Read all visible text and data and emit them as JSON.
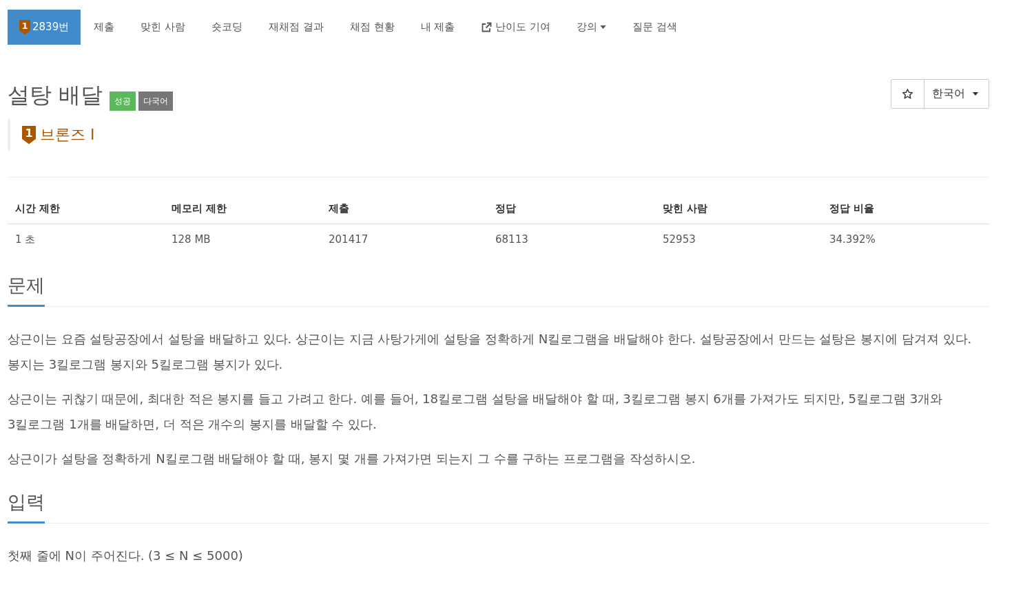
{
  "nav_tabs": [
    {
      "label": "2839번",
      "badge": "1",
      "kind": "link",
      "selected": true
    },
    {
      "label": "제출",
      "kind": "link",
      "selected": false
    },
    {
      "label": "맞힌 사람",
      "kind": "link",
      "selected": false
    },
    {
      "label": "숏코딩",
      "kind": "link",
      "selected": false
    },
    {
      "label": "재채점 결과",
      "kind": "link",
      "selected": false
    },
    {
      "label": "채점 현황",
      "kind": "link",
      "selected": false
    },
    {
      "label": "내 제출",
      "kind": "link",
      "selected": false
    },
    {
      "label": "난이도 기여",
      "kind": "external",
      "selected": false
    },
    {
      "label": "강의",
      "kind": "dropdown",
      "selected": false
    },
    {
      "label": "질문 검색",
      "kind": "link",
      "selected": false
    }
  ],
  "problem": {
    "title": "설탕 배달",
    "labels": [
      {
        "text": "성공",
        "color": "#5cb85c"
      },
      {
        "text": "다국어",
        "color": "#777777"
      }
    ],
    "tier": {
      "badge": "1",
      "name": "브론즈 I"
    },
    "language": "한국어"
  },
  "stats": {
    "columns": [
      "시간 제한",
      "메모리 제한",
      "제출",
      "정답",
      "맞힌 사람",
      "정답 비율"
    ],
    "rows": [
      [
        "1 초",
        "128 MB",
        "201417",
        "68113",
        "52953",
        "34.392%"
      ]
    ]
  },
  "sections": [
    {
      "title": "문제",
      "paragraphs": [
        "상근이는 요즘 설탕공장에서 설탕을 배달하고 있다. 상근이는 지금 사탕가게에 설탕을 정확하게 N킬로그램을 배달해야 한다. 설탕공장에서 만드는 설탕은 봉지에 담겨져 있다. 봉지는 3킬로그램 봉지와 5킬로그램 봉지가 있다.",
        "상근이는 귀찮기 때문에, 최대한 적은 봉지를 들고 가려고 한다. 예를 들어, 18킬로그램 설탕을 배달해야 할 때, 3킬로그램 봉지 6개를 가져가도 되지만, 5킬로그램 3개와 3킬로그램 1개를 배달하면, 더 적은 개수의 봉지를 배달할 수 있다.",
        "상근이가 설탕을 정확하게 N킬로그램 배달해야 할 때, 봉지 몇 개를 가져가면 되는지 그 수를 구하는 프로그램을 작성하시오."
      ]
    },
    {
      "title": "입력",
      "paragraphs": [
        "첫째 줄에 N이 주어진다. (3 ≤ N ≤ 5000)"
      ]
    }
  ]
}
